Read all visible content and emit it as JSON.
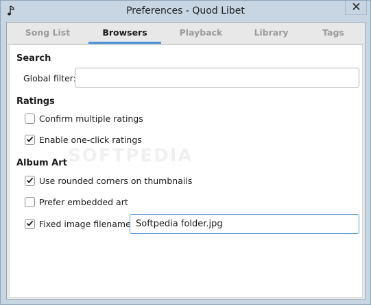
{
  "window": {
    "title": "Preferences - Quod Libet"
  },
  "tabs": [
    {
      "label": "Song List",
      "active": false
    },
    {
      "label": "Browsers",
      "active": true
    },
    {
      "label": "Playback",
      "active": false
    },
    {
      "label": "Library",
      "active": false
    },
    {
      "label": "Tags",
      "active": false
    }
  ],
  "search": {
    "title": "Search",
    "global_filter_label": "Global filter:",
    "global_filter_value": ""
  },
  "ratings": {
    "title": "Ratings",
    "confirm_multiple_label": "Confirm multiple ratings",
    "confirm_multiple_checked": false,
    "one_click_label": "Enable one-click ratings",
    "one_click_checked": true
  },
  "album_art": {
    "title": "Album Art",
    "rounded_corners_label": "Use rounded corners on thumbnails",
    "rounded_corners_checked": true,
    "embedded_art_label": "Prefer embedded art",
    "embedded_art_checked": false,
    "fixed_filename_label": "Fixed image filename:",
    "fixed_filename_checked": true,
    "fixed_filename_value": "Softpedia folder.jpg"
  },
  "watermark_text": "SOFTPEDIA",
  "icons": {
    "app": "quod-libet-icon",
    "close": "close-icon",
    "check": "checkmark-icon"
  },
  "colors": {
    "accent": "#4a90d9",
    "title_bar": "#c8d6e4",
    "close_button": "#c7d4e1"
  }
}
